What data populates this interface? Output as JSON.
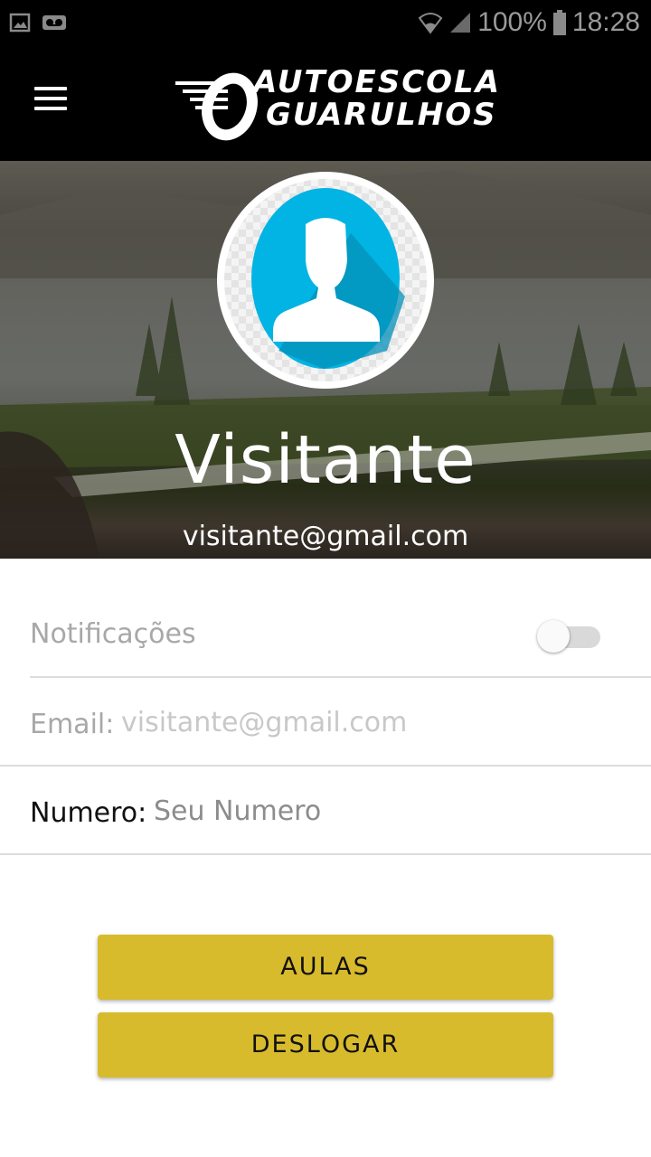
{
  "status_bar": {
    "left_icons": [
      "image-icon",
      "voicemail-icon"
    ],
    "wifi_icon": "wifi-icon",
    "signal_icon": "signal-icon",
    "battery_percent": "100%",
    "battery_icon": "battery-icon",
    "time": "18:28"
  },
  "app_bar": {
    "menu_icon": "hamburger-menu-icon",
    "logo_line1": "AUTOESCOLA",
    "logo_line2": "GUARULHOS"
  },
  "profile": {
    "avatar_icon": "user-avatar-icon",
    "name": "Visitante",
    "email": "visitante@gmail.com"
  },
  "settings": {
    "notifications_label": "Notificações",
    "notifications_enabled": false,
    "email_label": "Email:",
    "email_value": "visitante@gmail.com",
    "number_label": "Numero:",
    "number_placeholder": "Seu Numero",
    "number_value": ""
  },
  "actions": {
    "lessons_label": "AULAS",
    "logout_label": "DESLOGAR"
  },
  "colors": {
    "button": "#d8bb2c",
    "avatar_blue": "#02b4e3",
    "appbar": "#000000"
  }
}
